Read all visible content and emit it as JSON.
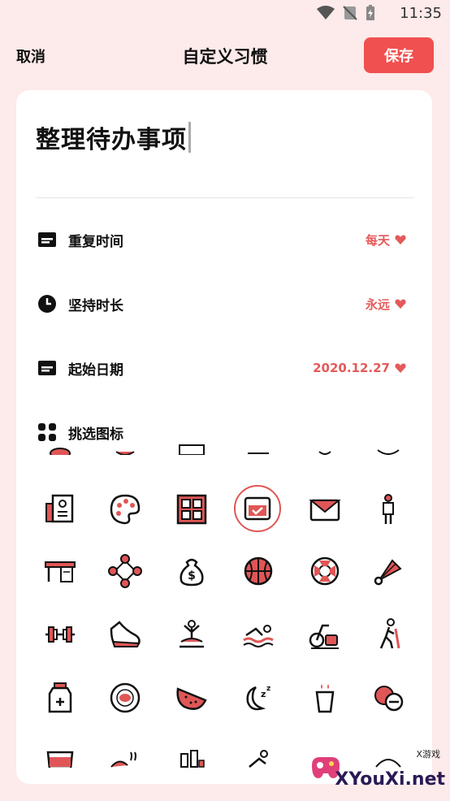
{
  "status_bar": {
    "time": "11:35"
  },
  "header": {
    "cancel_label": "取消",
    "title": "自定义习惯",
    "save_label": "保存"
  },
  "habit": {
    "name": "整理待办事项"
  },
  "settings": [
    {
      "label": "重复时间",
      "value": "每天",
      "icon": "calendar-icon"
    },
    {
      "label": "坚持时长",
      "value": "永远",
      "icon": "clock-icon"
    },
    {
      "label": "起始日期",
      "value": "2020.12.27",
      "icon": "calendar-icon"
    }
  ],
  "icon_picker": {
    "label": "挑选图标",
    "selected": "checked-calendar-icon"
  },
  "watermark": {
    "text": "XYouXi.net",
    "small": "X游戏"
  },
  "colors": {
    "accent": "#f0504f",
    "background": "#fdeaea",
    "value_text": "#e45a5a"
  }
}
